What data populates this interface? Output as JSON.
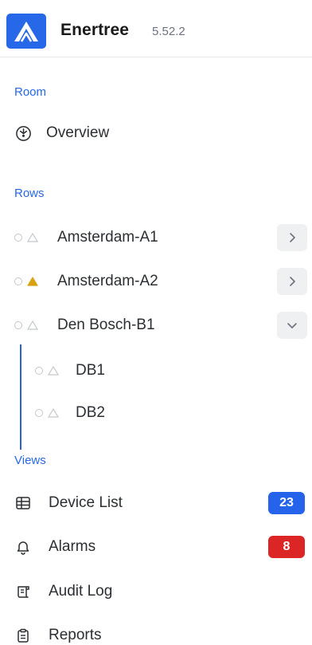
{
  "app": {
    "name": "Enertree",
    "version": "5.52.2"
  },
  "sections": {
    "room": "Room",
    "rows": "Rows",
    "views": "Views"
  },
  "room_items": [
    {
      "label": "Overview",
      "icon": "gauge-icon"
    }
  ],
  "rows": [
    {
      "label": "Amsterdam-A1",
      "warning": false,
      "expanded": false
    },
    {
      "label": "Amsterdam-A2",
      "warning": true,
      "expanded": false
    },
    {
      "label": "Den Bosch-B1",
      "warning": false,
      "expanded": true,
      "children": [
        {
          "label": "DB1"
        },
        {
          "label": "DB2"
        }
      ]
    }
  ],
  "views": [
    {
      "label": "Device List",
      "icon": "table-icon",
      "badge": "23",
      "badge_color": "#2563eb"
    },
    {
      "label": "Alarms",
      "icon": "bell-icon",
      "badge": "8",
      "badge_color": "#dc2626"
    },
    {
      "label": "Audit Log",
      "icon": "scroll-icon"
    },
    {
      "label": "Reports",
      "icon": "clipboard-icon"
    }
  ],
  "colors": {
    "accent": "#2668e8",
    "warning": "#d9a212",
    "tree_line": "#2d5fd3"
  }
}
